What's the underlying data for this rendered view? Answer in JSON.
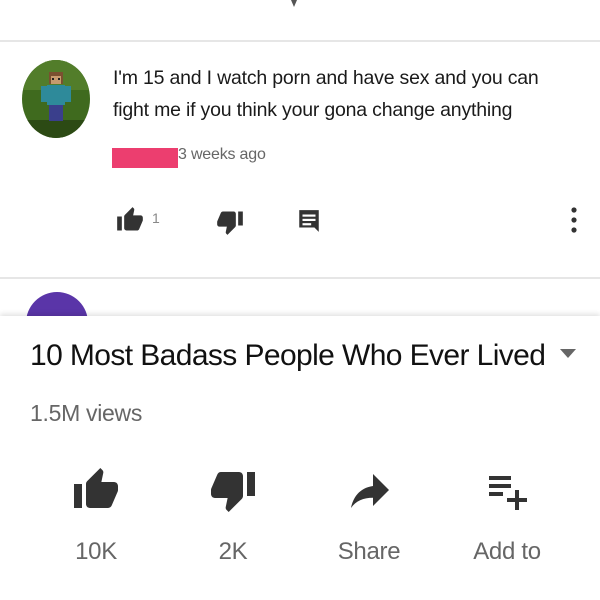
{
  "comment": {
    "text": "I'm 15 and I watch porn and have sex and you can fight me if you think your gona change anything",
    "timestamp": "3 weeks ago",
    "like_count": "1",
    "icons": [
      "thumb-up-icon",
      "thumb-down-icon",
      "reply-icon",
      "more-vert-icon"
    ],
    "redaction_color": "#ec3e6f"
  },
  "next_comment": {
    "avatar_color": "#5a35a8"
  },
  "video": {
    "title": "10 Most Badass People Who Ever Lived",
    "views": "1.5M views",
    "actions": [
      {
        "icon": "thumb-up-icon",
        "label": "10K"
      },
      {
        "icon": "thumb-down-icon",
        "label": "2K"
      },
      {
        "icon": "share-icon",
        "label": "Share"
      },
      {
        "icon": "add-to-playlist-icon",
        "label": "Add to"
      }
    ]
  },
  "colors": {
    "icon": "#333333",
    "secondary_text": "#666666",
    "divider": "#e6e6e6"
  }
}
